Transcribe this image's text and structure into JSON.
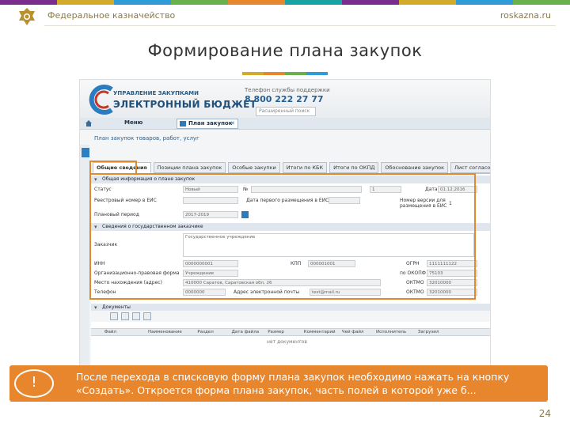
{
  "header": {
    "org_name": "Федеральное казначейство",
    "site": "roskazna.ru",
    "stripe_colors": [
      "#7b2d8e",
      "#d4aa2a",
      "#2f9bd7",
      "#6ab04c",
      "#e8862e",
      "#1aa3a3",
      "#7b2d8e",
      "#d4aa2a",
      "#2f9bd7",
      "#6ab04c"
    ]
  },
  "slide": {
    "title": "Формирование плана закупок",
    "title_bar_colors": [
      "#d4aa2a",
      "#e8862e",
      "#6ab04c",
      "#2f9bd7"
    ],
    "page_number": "24"
  },
  "app": {
    "brand_small": "УПРАВЛЕНИЕ ЗАКУПКАМИ",
    "brand_big": "ЭЛЕКТРОННЫЙ БЮДЖЕТ",
    "hotline_label": "Телефон службы поддержки",
    "hotline_number": "8 800 222 27 77",
    "search_placeholder": "Расширенный поиск",
    "menu_label": "Меню",
    "open_tab_label": "План закупок",
    "form_subtitle": "План закупок товаров, работ, услуг",
    "tabs": [
      {
        "label": "Общие сведения",
        "active": true
      },
      {
        "label": "Позиции плана закупок",
        "active": false
      },
      {
        "label": "Особые закупки",
        "active": false
      },
      {
        "label": "Итоги по КБК",
        "active": false
      },
      {
        "label": "Итоги по ОКПД",
        "active": false
      },
      {
        "label": "Обоснование закупок",
        "active": false
      },
      {
        "label": "Лист согласования",
        "active": false
      }
    ],
    "section_general": "Общая информация о плане закупок",
    "section_customer": "Сведения о государственном заказчике",
    "section_docs": "Документы",
    "fields": {
      "status_label": "Статус",
      "status_value": "Новый",
      "number_label": "№",
      "number_value": "1",
      "date_label": "Дата",
      "date_value": "01.12.2016",
      "registry_label": "Реестровый номер в ЕИС",
      "placement_date_label": "Дата первого размещения в ЕИС",
      "version_label": "Номер версии для размещения в ЕИС",
      "version_value": "1",
      "period_label": "Плановый период",
      "period_value": "2017-2019",
      "customer_label": "Заказчик",
      "customer_value": "Государственное учреждение",
      "inn_label": "ИНН",
      "inn_value": "0000000001",
      "kpp_label": "КПП",
      "kpp_value": "000001001",
      "ogrn_label": "ОГРН",
      "ogrn_value": "1111111122",
      "opf_label": "Организационно-правовая форма",
      "opf_value": "Учреждение",
      "okopf_label": "по ОКОПФ",
      "okopf_value": "75103",
      "address_label": "Место нахождения (адрес)",
      "address_value": "410000 Саратов, Саратовская обл, 26",
      "oktmo_label": "ОКТМО",
      "oktmo_value": "32010000",
      "phone_label": "Телефон",
      "phone_value": "0000000",
      "email_label": "Адрес электронной почты",
      "email_value": "test@mail.ru",
      "oktmo2_label": "ОКТМО",
      "oktmo2_value": "32010000"
    },
    "grid_columns": [
      "Файл",
      "Наименование",
      "Раздел",
      "Дата файла",
      "Размер",
      "Комментарий",
      "Чей файл",
      "Исполнитель",
      "Загрузил"
    ],
    "grid_note": "нет документов"
  },
  "callout": {
    "badge": "!",
    "text": "После перехода в списковую форму плана закупок необходимо нажать на кнопку «Создать». Откроется форма плана закупок, часть полей в которой уже б..."
  }
}
